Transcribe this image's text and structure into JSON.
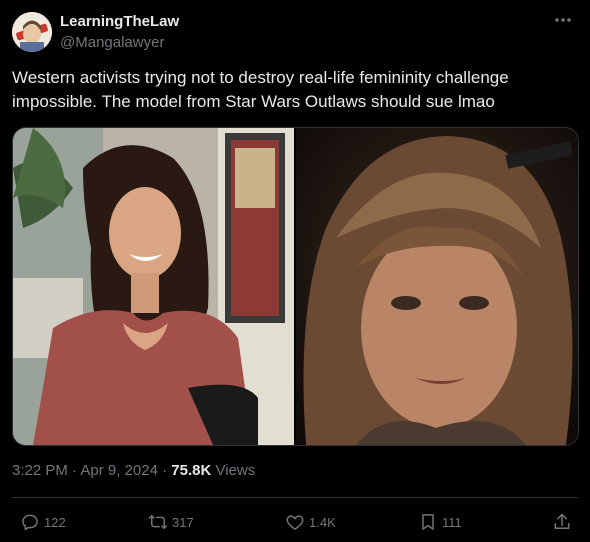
{
  "author": {
    "display_name": "LearningTheLaw",
    "handle": "@Mangalawyer",
    "avatar_icon": "avatar-image"
  },
  "more_icon": "more-options-icon",
  "tweet": {
    "text": "Western activists trying not to destroy real-life femininity challenge impossible. The model from Star Wars Outlaws should sue lmao"
  },
  "media": {
    "images": [
      {
        "name": "photo-real-model",
        "icon": "image"
      },
      {
        "name": "photo-game-character",
        "icon": "image"
      }
    ]
  },
  "meta": {
    "time": "3:22 PM",
    "sep": "·",
    "date": "Apr 9, 2024",
    "views_count": "75.8K",
    "views_label": "Views"
  },
  "actions": {
    "reply": {
      "icon": "reply-icon",
      "count": "122"
    },
    "retweet": {
      "icon": "retweet-icon",
      "count": "317"
    },
    "like": {
      "icon": "heart-icon",
      "count": "1.4K"
    },
    "bookmark": {
      "icon": "bookmark-icon",
      "count": "111"
    },
    "share": {
      "icon": "share-icon"
    }
  },
  "colors": {
    "background": "#000000",
    "text": "#e7e9ea",
    "muted": "#71767b",
    "border": "#2f3336"
  }
}
